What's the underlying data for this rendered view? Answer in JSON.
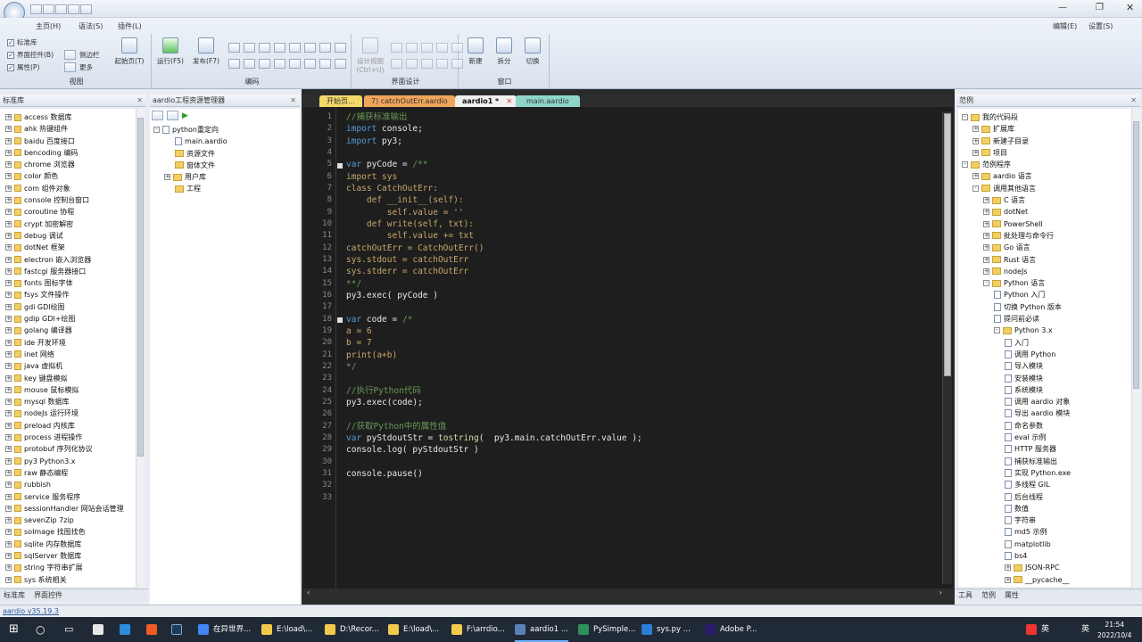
{
  "ribbon": {
    "tabs": [
      "主页(H)",
      "语法(S)",
      "插件(L)"
    ],
    "right_tools": [
      "编辑(E)",
      "设置(S)"
    ],
    "view_group": {
      "label": "视图",
      "items": [
        "标准库",
        "界面控件(B)",
        "属性(P)",
        "侧边栏",
        "更多"
      ]
    },
    "start_btn": "起始页(T)",
    "run_btn": "运行(F5)",
    "publish_btn": "发布(F7)",
    "code_group": "编码",
    "design_btn": "设计视图\n(Ctrl+U)",
    "ui_group": "界面设计",
    "window_btns": [
      "新建",
      "拆分",
      "切换"
    ],
    "window_group": "窗口"
  },
  "left_pane": {
    "title": "标准库",
    "items": [
      "access 数据库",
      "ahk 热键组件",
      "baidu 百度接口",
      "bencoding 编码",
      "chrome 浏览器",
      "color 颜色",
      "com 组件对象",
      "console 控制台窗口",
      "coroutine 协程",
      "crypt 加密解密",
      "debug 调试",
      "dotNet 框架",
      "electron 嵌入浏览器",
      "fastcgi 服务器接口",
      "fonts 图标字体",
      "fsys 文件操作",
      "gdi GDI绘图",
      "gdip GDI+绘图",
      "golang 编译器",
      "ide 开发环境",
      "inet 网络",
      "java 虚拟机",
      "key 键盘模拟",
      "mouse 鼠标模拟",
      "mysql 数据库",
      "nodeJs 运行环境",
      "preload 内核库",
      "process 进程操作",
      "protobuf 序列化协议",
      "py3 Python3.x",
      "raw 静态编程",
      "rubbish",
      "service 服务程序",
      "sessionHandler 网站会话管理",
      "sevenZip 7zip",
      "soImage 找图找色",
      "sqlite 内存数据库",
      "sqlServer 数据库",
      "string 字符串扩展",
      "sys 系统相关"
    ],
    "bottom_tabs": [
      "标准库",
      "界面控件"
    ]
  },
  "project_pane": {
    "title": "aardio工程资源管理器",
    "root": "python重定向",
    "items": [
      "main.aardio",
      "资源文件",
      "窗体文件",
      "用户库",
      "工程"
    ]
  },
  "editor": {
    "tabs": [
      "开始页...",
      "7) catchOutErr.aardio",
      "aardio1 *",
      "main.aardio"
    ],
    "lines": [
      "//捕获标准输出",
      "import console;",
      "import py3;",
      "",
      "var pyCode = /**",
      "import sys",
      "class CatchOutErr:",
      "    def __init__(self):",
      "        self.value = ''",
      "    def write(self, txt):",
      "        self.value += txt",
      "catchOutErr = CatchOutErr()",
      "sys.stdout = catchOutErr",
      "sys.stderr = catchOutErr",
      "**/",
      "py3.exec( pyCode )",
      "",
      "var code = /*",
      "a = 6",
      "b = 7",
      "print(a+b)",
      "*/",
      "",
      "//执行Python代码",
      "py3.exec(code);",
      "",
      "//获取Python中的属性值",
      "var pyStdoutStr = tostring(  py3.main.catchOutErr.value );",
      "console.log( pyStdoutStr )",
      "",
      "console.pause()",
      "",
      ""
    ]
  },
  "right_pane": {
    "title": "范例",
    "items": [
      {
        "t": "我的代码段",
        "lvl": 0,
        "pm": "-"
      },
      {
        "t": "扩展库",
        "lvl": 1,
        "pm": "+"
      },
      {
        "t": "新建子目录",
        "lvl": 1,
        "pm": "+"
      },
      {
        "t": "项目",
        "lvl": 1,
        "pm": "+"
      },
      {
        "t": "范例程序",
        "lvl": 0,
        "pm": "-"
      },
      {
        "t": "aardio 语言",
        "lvl": 1,
        "pm": "+"
      },
      {
        "t": "调用其他语言",
        "lvl": 1,
        "pm": "-"
      },
      {
        "t": "C 语言",
        "lvl": 2,
        "pm": "+"
      },
      {
        "t": "dotNet",
        "lvl": 2,
        "pm": "+"
      },
      {
        "t": "PowerShell",
        "lvl": 2,
        "pm": "+"
      },
      {
        "t": "批处理与命令行",
        "lvl": 2,
        "pm": "+"
      },
      {
        "t": "Go 语言",
        "lvl": 2,
        "pm": "+"
      },
      {
        "t": "Rust 语言",
        "lvl": 2,
        "pm": "+"
      },
      {
        "t": "nodeJs",
        "lvl": 2,
        "pm": "+"
      },
      {
        "t": "Python 语言",
        "lvl": 2,
        "pm": "-"
      },
      {
        "t": "Python 入门",
        "lvl": 3,
        "pm": "f"
      },
      {
        "t": "切换 Python 版本",
        "lvl": 3,
        "pm": "f"
      },
      {
        "t": "提问前必读",
        "lvl": 3,
        "pm": "f"
      },
      {
        "t": "Python 3.x",
        "lvl": 3,
        "pm": "-"
      },
      {
        "t": "入门",
        "lvl": 4,
        "pm": "f"
      },
      {
        "t": "调用 Python",
        "lvl": 4,
        "pm": "f"
      },
      {
        "t": "导入模块",
        "lvl": 4,
        "pm": "f"
      },
      {
        "t": "安装模块",
        "lvl": 4,
        "pm": "f"
      },
      {
        "t": "系统模块",
        "lvl": 4,
        "pm": "f"
      },
      {
        "t": "调用 aardio 对象",
        "lvl": 4,
        "pm": "f"
      },
      {
        "t": "导出 aardio 模块",
        "lvl": 4,
        "pm": "f"
      },
      {
        "t": "命名参数",
        "lvl": 4,
        "pm": "f"
      },
      {
        "t": "eval 示例",
        "lvl": 4,
        "pm": "f"
      },
      {
        "t": "HTTP 服务器",
        "lvl": 4,
        "pm": "f"
      },
      {
        "t": "捕获标准输出",
        "lvl": 4,
        "pm": "f"
      },
      {
        "t": "实现 Python.exe",
        "lvl": 4,
        "pm": "f"
      },
      {
        "t": "多线程 GIL",
        "lvl": 4,
        "pm": "f"
      },
      {
        "t": "后台线程",
        "lvl": 4,
        "pm": "f"
      },
      {
        "t": "数值",
        "lvl": 4,
        "pm": "f"
      },
      {
        "t": "字符串",
        "lvl": 4,
        "pm": "f"
      },
      {
        "t": "md5 示例",
        "lvl": 4,
        "pm": "f"
      },
      {
        "t": "matplotlib",
        "lvl": 4,
        "pm": "f"
      },
      {
        "t": "bs4",
        "lvl": 4,
        "pm": "f"
      },
      {
        "t": "JSON-RPC",
        "lvl": 4,
        "pm": "+"
      },
      {
        "t": "__pycache__",
        "lvl": 4,
        "pm": "+"
      }
    ],
    "bottom_tabs": [
      "工具",
      "范例",
      "属性"
    ]
  },
  "status": {
    "version": "aardio v35.19.3"
  },
  "taskbar": {
    "items": [
      "在异世界...",
      "E:\\load\\...",
      "D:\\Recor...",
      "E:\\load\\...",
      "F:\\arrdio...",
      "aardio1 ...",
      "PySimple...",
      "sys.py ...",
      "Adobe P..."
    ],
    "lang": "英",
    "time": "21:54",
    "date": "2022/10/4",
    "ime": "英"
  }
}
